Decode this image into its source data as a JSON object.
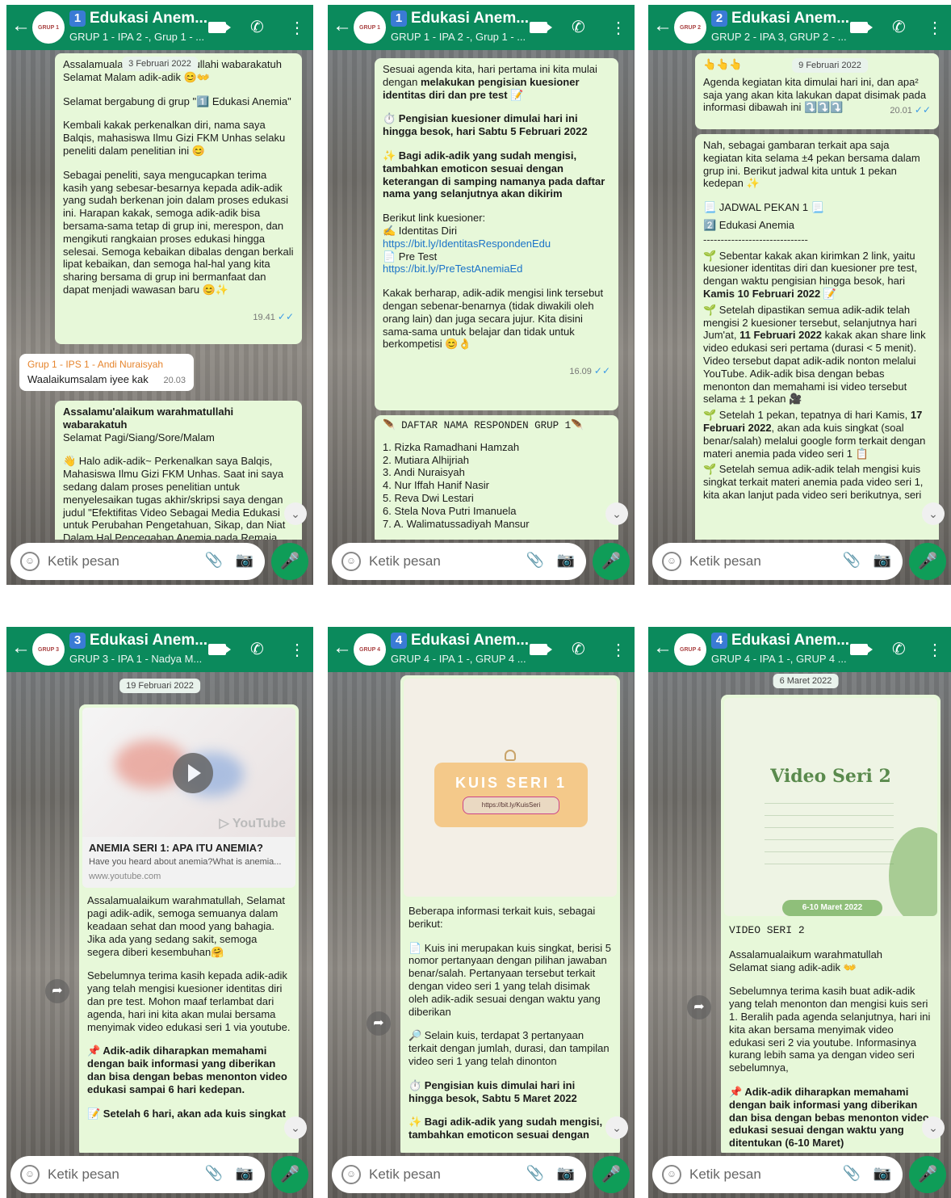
{
  "input_placeholder": "Ketik pesan",
  "screens": [
    {
      "avatar": "GRUP 1",
      "num": "1",
      "title": "Edukasi Anem...",
      "subtitle": "GRUP 1 - IPA 2 -, Grup 1 - ...",
      "date": "3 Februari 2022",
      "m1": {
        "l1": "Assalamualaikum warahmatullahi wabarakatuh",
        "l2": "Selamat Malam adik-adik 😊👐",
        "l3": "Selamat bergabung di grup \"1️⃣ Edukasi Anemia\"",
        "l4": "Kembali kakak perkenalkan diri, nama saya Balqis, mahasiswa Ilmu Gizi FKM Unhas selaku peneliti dalam penelitian ini 😊",
        "l5": "Sebagai peneliti, saya mengucapkan terima kasih yang sebesar-besarnya kepada adik-adik yang sudah berkenan join dalam proses edukasi ini. Harapan kakak, semoga adik-adik bisa bersama-sama tetap di grup ini, merespon, dan mengikuti rangkaian proses edukasi hingga selesai. Semoga kebaikan dibalas dengan berkali lipat kebaikan, dan semoga hal-hal yang kita sharing bersama di grup ini bermanfaat dan dapat menjadi wawasan baru 😊✨",
        "time": "19.41"
      },
      "m2": {
        "sender": "Grup 1 - IPS 1 - Andi Nuraisyah",
        "text": "Waalaikumsalam iyee kak",
        "time": "20.03"
      },
      "m3": {
        "l1": "Assalamu'alaikum warahmatullahi wabarakatuh",
        "l2": "Selamat Pagi/Siang/Sore/Malam",
        "l3": "👋 Halo adik-adik~ Perkenalkan saya Balqis, Mahasiswa Ilmu Gizi FKM Unhas. Saat ini saya sedang dalam proses penelitian untuk menyelesaikan tugas akhir/skripsi saya dengan judul \"Efektifitas Video Sebagai Media Edukasi untuk Perubahan Pengetahuan, Sikap, dan Niat Dalam Hal Pencegahan Anemia pada Remaja"
      }
    },
    {
      "avatar": "GRUP 1",
      "num": "1",
      "title": "Edukasi Anem...",
      "subtitle": "GRUP 1 - IPA 2 -, Grup 1 - ...",
      "m1": {
        "l1a": "Sesuai agenda kita, hari pertama ini kita mulai dengan ",
        "l1b": "melakukan pengisian kuesioner identitas diri dan pre test",
        "l1c": " 📝",
        "l2": "⏱️ Pengisian kuesioner dimulai hari ini hingga besok, hari Sabtu 5 Februari 2022",
        "l3": "✨ Bagi adik-adik yang sudah mengisi, tambahkan emoticon sesuai dengan keterangan di samping namanya pada daftar nama yang selanjutnya akan dikirim",
        "l4": "Berikut link kuesioner:",
        "l5": "✍️ Identitas Diri",
        "link1": "https://bit.ly/IdentitasRespondenEdu",
        "l6": "📄 Pre Test",
        "link2": "https://bit.ly/PreTestAnemiaEd",
        "l7": "Kakak berharap, adik-adik mengisi link tersebut dengan sebenar-benarnya (tidak diwakili oleh orang lain) dan juga secara jujur. Kita disini sama-sama untuk belajar dan tidak untuk berkompetisi 😊👌",
        "time": "16.09"
      },
      "m2": {
        "title": "🪶 DAFTAR NAMA RESPONDEN GRUP 1🪶",
        "names": [
          "1. Rizka Ramadhani Hamzah",
          "2. Mutiara Alhijriah",
          "3. Andi Nuraisyah",
          "4. Nur Iffah Hanif Nasir",
          "5. Reva Dwi Lestari",
          "6. Stela Nova Putri Imanuela",
          "7. A. Walimatussadiyah Mansur"
        ]
      }
    },
    {
      "avatar": "GRUP 2",
      "num": "2",
      "title": "Edukasi Anem...",
      "subtitle": "GRUP 2 - IPA 3, GRUP 2 - ...",
      "date": "9 Februari 2022",
      "m1": {
        "l0": "👆👆👆",
        "l1": "Agenda kegiatan kita dimulai hari ini, dan apa² saja yang akan kita lakukan dapat disimak pada informasi dibawah ini ⤵️⤵️⤵️",
        "time": "20.01"
      },
      "m2": {
        "l1": "Nah, sebagai gambaran terkait apa saja kegiatan kita selama ±4 pekan bersama dalam grup ini. Berikut jadwal kita untuk 1 pekan kedepan ✨",
        "l2": "📃 JADWAL PEKAN 1 📃",
        "l3": "2️⃣ Edukasi Anemia",
        "l4": "------------------------------",
        "l5": "🌱 Sebentar kakak akan kirimkan 2 link, yaitu kuesioner identitas diri dan kuesioner pre test, dengan waktu pengisian hingga besok, hari ",
        "l5b": "Kamis 10 Februari 2022",
        "l5c": " 📝",
        "l6": "🌱 Setelah dipastikan semua adik-adik telah mengisi 2 kuesioner tersebut, selanjutnya hari Jum'at, ",
        "l6b": "11 Februari 2022",
        "l6c": " kakak akan share link video edukasi seri pertama (durasi < 5 menit). Video tersebut dapat adik-adik nonton melalui YouTube. Adik-adik bisa dengan bebas menonton dan memahami isi video tersebut selama ± 1 pekan 🎥",
        "l7": "🌱 Setelah 1 pekan, tepatnya di hari Kamis, ",
        "l7b": "17 Februari 2022",
        "l7c": ", akan ada kuis singkat (soal benar/salah) melalui google form terkait dengan materi anemia pada video seri 1 📋",
        "l8": "🌱 Setelah semua adik-adik telah mengisi kuis singkat terkait materi anemia pada video seri 1, kita akan lanjut pada video seri berikutnya, seri"
      }
    },
    {
      "avatar": "GRUP 3",
      "num": "3",
      "title": "Edukasi Anem...",
      "subtitle": "GRUP 3 - IPA 1 - Nadya M...",
      "date": "19 Februari 2022",
      "yt_logo": "▷ YouTube",
      "yt_title": "ANEMIA SERI 1: APA ITU ANEMIA?",
      "yt_desc": "Have you heard about anemia?What is anemia...",
      "yt_url": "www.youtube.com",
      "l1": "Assalamualaikum warahmatullah, Selamat pagi adik-adik, semoga semuanya dalam keadaan sehat dan mood yang bahagia. Jika ada yang sedang sakit, semoga segera diberi kesembuhan🤗",
      "l2": "Sebelumnya terima kasih kepada adik-adik yang telah mengisi kuesioner identitas diri dan pre test. Mohon maaf terlambat dari agenda, hari ini kita akan mulai bersama menyimak video edukasi seri 1 via youtube.",
      "l3": "📌 Adik-adik diharapkan memahami dengan baik informasi yang diberikan dan bisa dengan bebas menonton video edukasi sampai 6 hari kedepan.",
      "l4": "📝 Setelah 6 hari, akan ada kuis singkat"
    },
    {
      "avatar": "GRUP 4",
      "num": "4",
      "title": "Edukasi Anem...",
      "subtitle": "GRUP 4 - IPA 1 -, GRUP 4 ...",
      "img_title": "KUIS SERI 1",
      "img_url": "https://bit.ly/KuisSeri",
      "l1": "Beberapa informasi terkait kuis, sebagai berikut:",
      "l2": "📄 Kuis ini merupakan kuis singkat, berisi 5 nomor pertanyaan dengan pilihan jawaban benar/salah. Pertanyaan tersebut terkait dengan video seri 1 yang telah disimak oleh adik-adik sesuai dengan waktu yang diberikan",
      "l3": "🔎 Selain kuis, terdapat 3 pertanyaan terkait dengan jumlah, durasi, dan tampilan video seri 1 yang telah dinonton",
      "l4": "⏱️ Pengisian kuis dimulai hari ini hingga besok, Sabtu 5 Maret 2022",
      "l5": "✨ Bagi adik-adik yang sudah mengisi, tambahkan emoticon sesuai dengan"
    },
    {
      "avatar": "GRUP 4",
      "num": "4",
      "title": "Edukasi Anem...",
      "subtitle": "GRUP 4 - IPA 1 -, GRUP 4 ...",
      "date": "6 Maret 2022",
      "img_title": "Video Seri 2",
      "img_date": "6-10 Maret 2022",
      "l1": "VIDEO SERI 2",
      "l2": "Assalamualaikum warahmatullah",
      "l3": "Selamat siang adik-adik 👐",
      "l4": "Sebelumnya terima kasih buat adik-adik yang telah menonton dan mengisi kuis seri 1. Beralih pada agenda selanjutnya, hari ini kita akan bersama menyimak video edukasi seri 2 via youtube. Informasinya kurang lebih sama ya dengan video seri sebelumnya,",
      "l5": "📌 Adik-adik diharapkan memahami dengan baik informasi yang diberikan dan bisa dengan bebas menonton video edukasi sesuai dengan waktu yang ditentukan (6-10 Maret)"
    }
  ]
}
